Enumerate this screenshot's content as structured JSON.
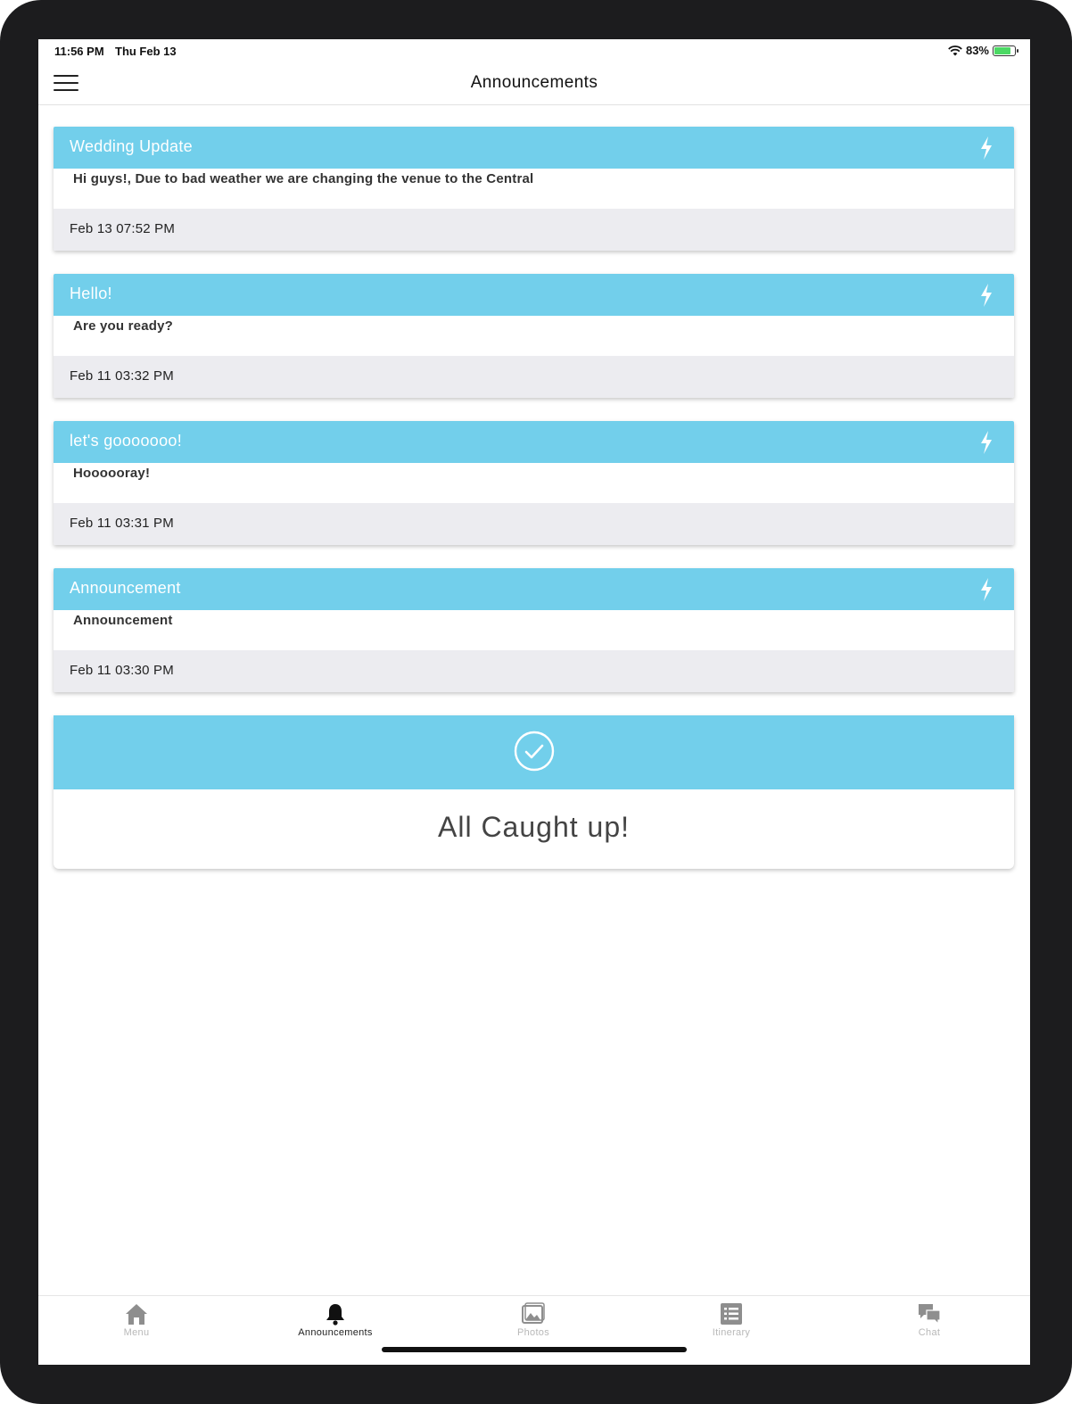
{
  "status_bar": {
    "time": "11:56 PM",
    "date": "Thu Feb 13",
    "battery": "83%"
  },
  "nav": {
    "title": "Announcements"
  },
  "announcements": [
    {
      "title": "Wedding Update",
      "message": "Hi guys!, Due to bad weather we are changing the venue to the Central",
      "time": "Feb 13 07:52 PM"
    },
    {
      "title": "Hello!",
      "message": "Are you ready?",
      "time": "Feb 11 03:32 PM"
    },
    {
      "title": "let's gooooooo!",
      "message": "Hoooooray!",
      "time": "Feb 11 03:31 PM"
    },
    {
      "title": "Announcement",
      "message": "Announcement",
      "time": "Feb 11 03:30 PM"
    }
  ],
  "caught_up": {
    "text": "All Caught up!"
  },
  "tabs": [
    {
      "label": "Menu",
      "icon": "home-icon",
      "active": false
    },
    {
      "label": "Announcements",
      "icon": "bell-icon",
      "active": true
    },
    {
      "label": "Photos",
      "icon": "photos-icon",
      "active": false
    },
    {
      "label": "Itinerary",
      "icon": "list-icon",
      "active": false
    },
    {
      "label": "Chat",
      "icon": "chat-icon",
      "active": false
    }
  ],
  "colors": {
    "accent": "#72cfeb",
    "footer_bg": "#ececf0",
    "battery_fill": "#4cd964"
  }
}
